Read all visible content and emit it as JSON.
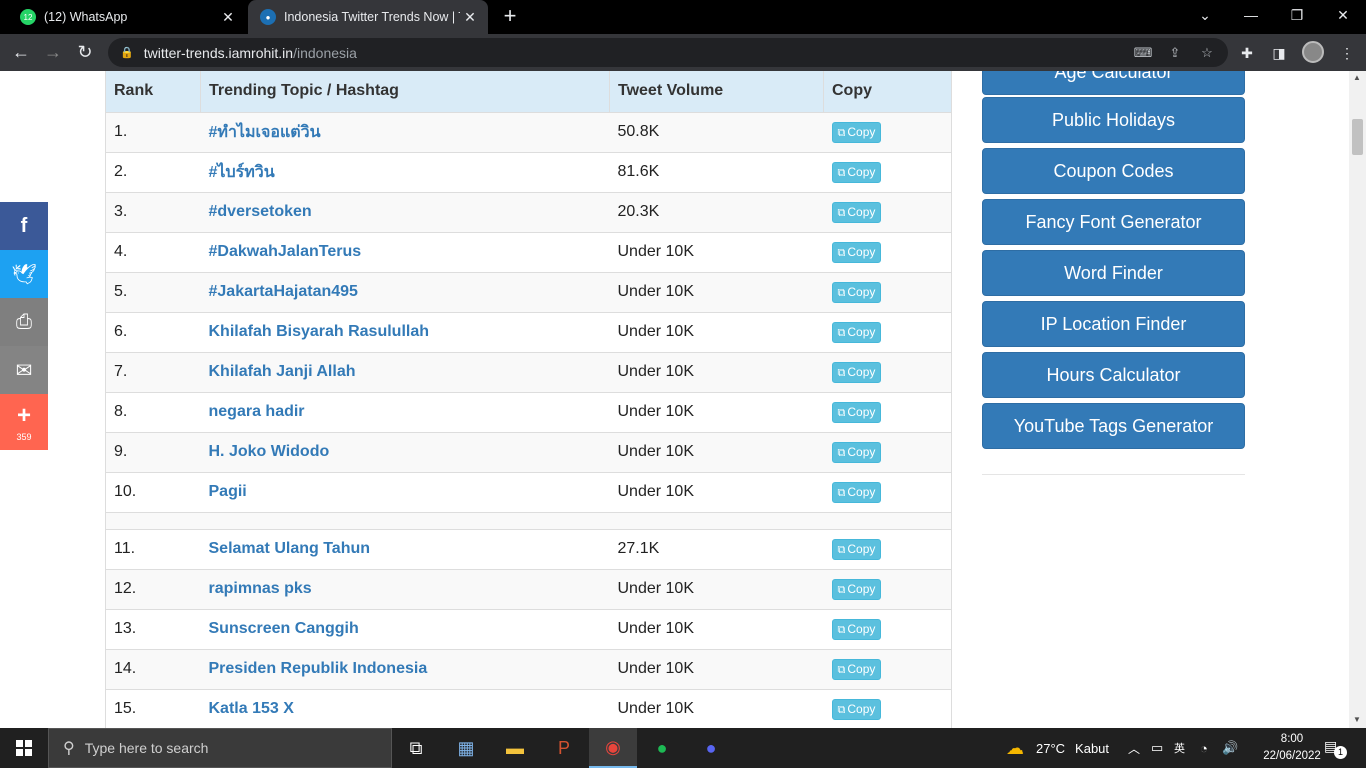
{
  "browser": {
    "tabs": [
      {
        "title": "(12) WhatsApp",
        "badge": "12",
        "active": false
      },
      {
        "title": "Indonesia Twitter Trends Now | To",
        "active": true
      }
    ],
    "url_host": "twitter-trends.iamrohit.in",
    "url_path": "/indonesia"
  },
  "table": {
    "headers": {
      "rank": "Rank",
      "topic": "Trending Topic / Hashtag",
      "volume": "Tweet Volume",
      "copy": "Copy"
    },
    "copy_label": "Copy",
    "rows": [
      {
        "rank": "1.",
        "topic": "#ทำไมเจอแต่วิน",
        "volume": "50.8K"
      },
      {
        "rank": "2.",
        "topic": "#ไบร์ทวิน",
        "volume": "81.6K"
      },
      {
        "rank": "3.",
        "topic": "#dversetoken",
        "volume": "20.3K"
      },
      {
        "rank": "4.",
        "topic": "#DakwahJalanTerus",
        "volume": "Under 10K"
      },
      {
        "rank": "5.",
        "topic": "#JakartaHajatan495",
        "volume": "Under 10K"
      },
      {
        "rank": "6.",
        "topic": "Khilafah Bisyarah Rasulullah",
        "volume": "Under 10K"
      },
      {
        "rank": "7.",
        "topic": "Khilafah Janji Allah",
        "volume": "Under 10K"
      },
      {
        "rank": "8.",
        "topic": "negara hadir",
        "volume": "Under 10K"
      },
      {
        "rank": "9.",
        "topic": "H. Joko Widodo",
        "volume": "Under 10K"
      },
      {
        "rank": "10.",
        "topic": "Pagii",
        "volume": "Under 10K"
      }
    ],
    "rows2": [
      {
        "rank": "11.",
        "topic": "Selamat Ulang Tahun",
        "volume": "27.1K"
      },
      {
        "rank": "12.",
        "topic": "rapimnas pks",
        "volume": "Under 10K"
      },
      {
        "rank": "13.",
        "topic": "Sunscreen Canggih",
        "volume": "Under 10K"
      },
      {
        "rank": "14.",
        "topic": "Presiden Republik Indonesia",
        "volume": "Under 10K"
      },
      {
        "rank": "15.",
        "topic": "Katla 153 X",
        "volume": "Under 10K"
      }
    ]
  },
  "sidebar": {
    "buttons": [
      "Age Calculator",
      "Public Holidays",
      "Coupon Codes",
      "Fancy Font Generator",
      "Word Finder",
      "IP Location Finder",
      "Hours Calculator",
      "YouTube Tags Generator"
    ]
  },
  "share": {
    "count": "359",
    "colors": {
      "facebook": "#3b5998",
      "twitter": "#1da1f2",
      "print": "#7f7f7f",
      "email": "#848484",
      "more": "#ff6550"
    }
  },
  "taskbar": {
    "search_placeholder": "Type here to search",
    "weather_temp": "27°C",
    "weather_text": "Kabut",
    "time": "8:00",
    "date": "22/06/2022",
    "notifications": "1"
  }
}
